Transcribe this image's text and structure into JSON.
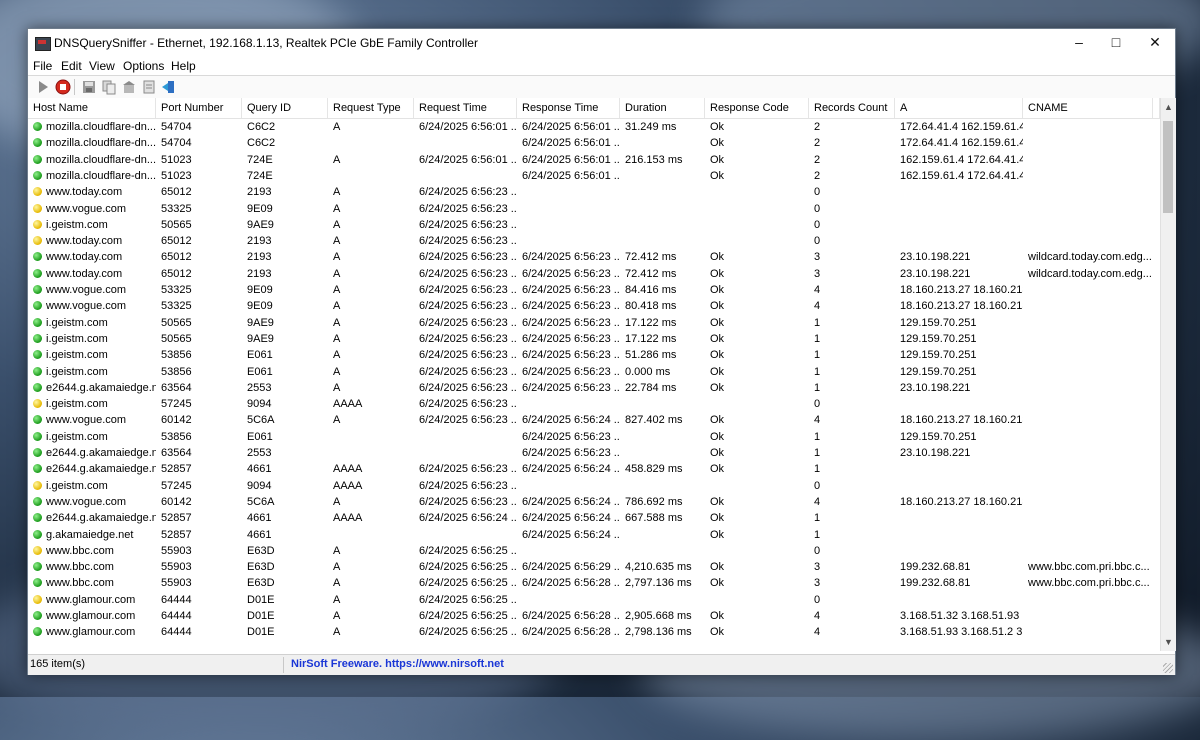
{
  "window": {
    "title": "DNSQuerySniffer  -  Ethernet, 192.168.1.13, Realtek PCIe GbE Family Controller"
  },
  "menu": [
    "File",
    "Edit",
    "View",
    "Options",
    "Help"
  ],
  "columns": [
    "Host Name",
    "Port Number",
    "Query ID",
    "Request Type",
    "Request Time",
    "Response Time",
    "Duration",
    "Response Code",
    "Records Count",
    "A",
    "CNAME"
  ],
  "rows": [
    {
      "status": "green",
      "cells": [
        "mozilla.cloudflare-dn...",
        "54704",
        "C6C2",
        "A",
        "6/24/2025 6:56:01 ...",
        "6/24/2025 6:56:01 ...",
        "31.249 ms",
        "Ok",
        "2",
        "172.64.41.4  162.159.61.4",
        ""
      ]
    },
    {
      "status": "green",
      "cells": [
        "mozilla.cloudflare-dn...",
        "54704",
        "C6C2",
        "",
        "",
        "6/24/2025 6:56:01 ...",
        "",
        "Ok",
        "2",
        "172.64.41.4  162.159.61.4",
        ""
      ]
    },
    {
      "status": "green",
      "cells": [
        "mozilla.cloudflare-dn...",
        "51023",
        "724E",
        "A",
        "6/24/2025 6:56:01 ...",
        "6/24/2025 6:56:01 ...",
        "216.153 ms",
        "Ok",
        "2",
        "162.159.61.4  172.64.41.4",
        ""
      ]
    },
    {
      "status": "green",
      "cells": [
        "mozilla.cloudflare-dn...",
        "51023",
        "724E",
        "",
        "",
        "6/24/2025 6:56:01 ...",
        "",
        "Ok",
        "2",
        "162.159.61.4  172.64.41.4",
        ""
      ]
    },
    {
      "status": "yellow",
      "cells": [
        "www.today.com",
        "65012",
        "2193",
        "A",
        "6/24/2025 6:56:23 ...",
        "",
        "",
        "",
        "0",
        "",
        ""
      ]
    },
    {
      "status": "yellow",
      "cells": [
        "www.vogue.com",
        "53325",
        "9E09",
        "A",
        "6/24/2025 6:56:23 ...",
        "",
        "",
        "",
        "0",
        "",
        ""
      ]
    },
    {
      "status": "yellow",
      "cells": [
        "i.geistm.com",
        "50565",
        "9AE9",
        "A",
        "6/24/2025 6:56:23 ...",
        "",
        "",
        "",
        "0",
        "",
        ""
      ]
    },
    {
      "status": "yellow",
      "cells": [
        "www.today.com",
        "65012",
        "2193",
        "A",
        "6/24/2025 6:56:23 ...",
        "",
        "",
        "",
        "0",
        "",
        ""
      ]
    },
    {
      "status": "green",
      "cells": [
        "www.today.com",
        "65012",
        "2193",
        "A",
        "6/24/2025 6:56:23 ...",
        "6/24/2025 6:56:23 ...",
        "72.412 ms",
        "Ok",
        "3",
        "23.10.198.221",
        "wildcard.today.com.edg..."
      ]
    },
    {
      "status": "green",
      "cells": [
        "www.today.com",
        "65012",
        "2193",
        "A",
        "6/24/2025 6:56:23 ...",
        "6/24/2025 6:56:23 ...",
        "72.412 ms",
        "Ok",
        "3",
        "23.10.198.221",
        "wildcard.today.com.edg..."
      ]
    },
    {
      "status": "green",
      "cells": [
        "www.vogue.com",
        "53325",
        "9E09",
        "A",
        "6/24/2025 6:56:23 ...",
        "6/24/2025 6:56:23 ...",
        "84.416 ms",
        "Ok",
        "4",
        "18.160.213.27  18.160.213...",
        ""
      ]
    },
    {
      "status": "green",
      "cells": [
        "www.vogue.com",
        "53325",
        "9E09",
        "A",
        "6/24/2025 6:56:23 ...",
        "6/24/2025 6:56:23 ...",
        "80.418 ms",
        "Ok",
        "4",
        "18.160.213.27  18.160.213...",
        ""
      ]
    },
    {
      "status": "green",
      "cells": [
        "i.geistm.com",
        "50565",
        "9AE9",
        "A",
        "6/24/2025 6:56:23 ...",
        "6/24/2025 6:56:23 ...",
        "17.122 ms",
        "Ok",
        "1",
        "129.159.70.251",
        ""
      ]
    },
    {
      "status": "green",
      "cells": [
        "i.geistm.com",
        "50565",
        "9AE9",
        "A",
        "6/24/2025 6:56:23 ...",
        "6/24/2025 6:56:23 ...",
        "17.122 ms",
        "Ok",
        "1",
        "129.159.70.251",
        ""
      ]
    },
    {
      "status": "green",
      "cells": [
        "i.geistm.com",
        "53856",
        "E061",
        "A",
        "6/24/2025 6:56:23 ...",
        "6/24/2025 6:56:23 ...",
        "51.286 ms",
        "Ok",
        "1",
        "129.159.70.251",
        ""
      ]
    },
    {
      "status": "green",
      "cells": [
        "i.geistm.com",
        "53856",
        "E061",
        "A",
        "6/24/2025 6:56:23 ...",
        "6/24/2025 6:56:23 ...",
        "0.000 ms",
        "Ok",
        "1",
        "129.159.70.251",
        ""
      ]
    },
    {
      "status": "green",
      "cells": [
        "e2644.g.akamaiedge.n...",
        "63564",
        "2553",
        "A",
        "6/24/2025 6:56:23 ...",
        "6/24/2025 6:56:23 ...",
        "22.784 ms",
        "Ok",
        "1",
        "23.10.198.221",
        ""
      ]
    },
    {
      "status": "yellow",
      "cells": [
        "i.geistm.com",
        "57245",
        "9094",
        "AAAA",
        "6/24/2025 6:56:23 ...",
        "",
        "",
        "",
        "0",
        "",
        ""
      ]
    },
    {
      "status": "green",
      "cells": [
        "www.vogue.com",
        "60142",
        "5C6A",
        "A",
        "6/24/2025 6:56:23 ...",
        "6/24/2025 6:56:24 ...",
        "827.402 ms",
        "Ok",
        "4",
        "18.160.213.27  18.160.213...",
        ""
      ]
    },
    {
      "status": "green",
      "cells": [
        "i.geistm.com",
        "53856",
        "E061",
        "",
        "",
        "6/24/2025 6:56:23 ...",
        "",
        "Ok",
        "1",
        "129.159.70.251",
        ""
      ]
    },
    {
      "status": "green",
      "cells": [
        "e2644.g.akamaiedge.n...",
        "63564",
        "2553",
        "",
        "",
        "6/24/2025 6:56:23 ...",
        "",
        "Ok",
        "1",
        "23.10.198.221",
        ""
      ]
    },
    {
      "status": "green",
      "cells": [
        "e2644.g.akamaiedge.n...",
        "52857",
        "4661",
        "AAAA",
        "6/24/2025 6:56:23 ...",
        "6/24/2025 6:56:24 ...",
        "458.829 ms",
        "Ok",
        "1",
        "",
        ""
      ]
    },
    {
      "status": "yellow",
      "cells": [
        "i.geistm.com",
        "57245",
        "9094",
        "AAAA",
        "6/24/2025 6:56:23 ...",
        "",
        "",
        "",
        "0",
        "",
        ""
      ]
    },
    {
      "status": "green",
      "cells": [
        "www.vogue.com",
        "60142",
        "5C6A",
        "A",
        "6/24/2025 6:56:23 ...",
        "6/24/2025 6:56:24 ...",
        "786.692 ms",
        "Ok",
        "4",
        "18.160.213.27  18.160.213...",
        ""
      ]
    },
    {
      "status": "green",
      "cells": [
        "e2644.g.akamaiedge.n...",
        "52857",
        "4661",
        "AAAA",
        "6/24/2025 6:56:24 ...",
        "6/24/2025 6:56:24 ...",
        "667.588 ms",
        "Ok",
        "1",
        "",
        ""
      ]
    },
    {
      "status": "green",
      "cells": [
        "g.akamaiedge.net",
        "52857",
        "4661",
        "",
        "",
        "6/24/2025 6:56:24 ...",
        "",
        "Ok",
        "1",
        "",
        ""
      ]
    },
    {
      "status": "yellow",
      "cells": [
        "www.bbc.com",
        "55903",
        "E63D",
        "A",
        "6/24/2025 6:56:25 ...",
        "",
        "",
        "",
        "0",
        "",
        ""
      ]
    },
    {
      "status": "green",
      "cells": [
        "www.bbc.com",
        "55903",
        "E63D",
        "A",
        "6/24/2025 6:56:25 ...",
        "6/24/2025 6:56:29 ...",
        "4,210.635 ms",
        "Ok",
        "3",
        "199.232.68.81",
        "www.bbc.com.pri.bbc.c..."
      ]
    },
    {
      "status": "green",
      "cells": [
        "www.bbc.com",
        "55903",
        "E63D",
        "A",
        "6/24/2025 6:56:25 ...",
        "6/24/2025 6:56:28 ...",
        "2,797.136 ms",
        "Ok",
        "3",
        "199.232.68.81",
        "www.bbc.com.pri.bbc.c..."
      ]
    },
    {
      "status": "yellow",
      "cells": [
        "www.glamour.com",
        "64444",
        "D01E",
        "A",
        "6/24/2025 6:56:25 ...",
        "",
        "",
        "",
        "0",
        "",
        ""
      ]
    },
    {
      "status": "green",
      "cells": [
        "www.glamour.com",
        "64444",
        "D01E",
        "A",
        "6/24/2025 6:56:25 ...",
        "6/24/2025 6:56:28 ...",
        "2,905.668 ms",
        "Ok",
        "4",
        "3.168.51.32  3.168.51.93 ...",
        ""
      ]
    },
    {
      "status": "green",
      "cells": [
        "www.glamour.com",
        "64444",
        "D01E",
        "A",
        "6/24/2025 6:56:25 ...",
        "6/24/2025 6:56:28 ...",
        "2,798.136 ms",
        "Ok",
        "4",
        "3.168.51.93  3.168.51.2  3....",
        ""
      ]
    }
  ],
  "status": {
    "items": "165 item(s)",
    "link": "NirSoft Freeware. https://www.nirsoft.net"
  },
  "status_colors": {
    "green": "#1a9a1a",
    "yellow": "#e6b800"
  },
  "toolbar_icons": [
    "play-icon",
    "stop-icon",
    "save-icon",
    "copy-icon",
    "html-report-icon",
    "properties-icon",
    "exit-icon"
  ]
}
